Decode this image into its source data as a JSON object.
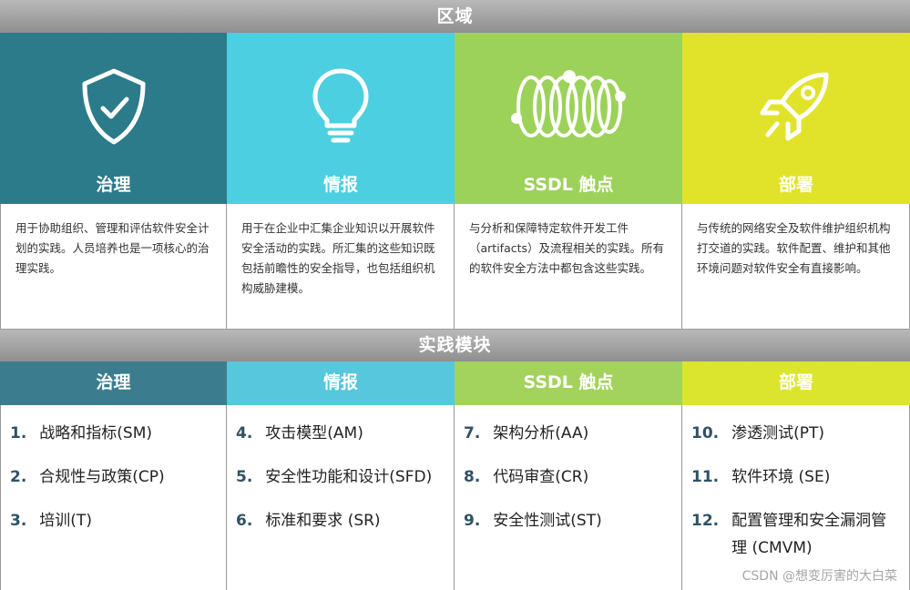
{
  "top_band": "区域",
  "middle_band": "实践模块",
  "colors": {
    "governance": "#2b7b8a",
    "intelligence": "#4ccfe1",
    "ssdl": "#9dd25a",
    "deployment": "#e1e32b",
    "governance_head": "#3b7d8e",
    "intelligence_head": "#56c7dc",
    "ssdl_head": "#a3d35c",
    "deployment_head": "#dce52e"
  },
  "domains": [
    {
      "title": "治理",
      "icon": "shield-check-icon",
      "description": "用于协助组织、管理和评估软件安全计划的实践。人员培养也是一项核心的治理实践。"
    },
    {
      "title": "情报",
      "icon": "lightbulb-icon",
      "description": "用于在企业中汇集企业知识以开展软件安全活动的实践。所汇集的这些知识既包括前瞻性的安全指导，也包括组织机构威胁建模。"
    },
    {
      "title": "SSDL 触点",
      "icon": "coil-icon",
      "description": "与分析和保障特定软件开发工件（artifacts）及流程相关的实践。所有的软件安全方法中都包含这些实践。"
    },
    {
      "title": "部署",
      "icon": "rocket-icon",
      "description": "与传统的网络安全及软件维护组织机构打交道的实践。软件配置、维护和其他环境问题对软件安全有直接影响。"
    }
  ],
  "modules": [
    {
      "title": "治理",
      "items": [
        {
          "num": "1.",
          "label": "战略和指标(SM)"
        },
        {
          "num": "2.",
          "label": "合规性与政策(CP)"
        },
        {
          "num": "3.",
          "label": "培训(T)"
        }
      ]
    },
    {
      "title": "情报",
      "items": [
        {
          "num": "4.",
          "label": "攻击模型(AM)"
        },
        {
          "num": "5.",
          "label": "安全性功能和设计(SFD)"
        },
        {
          "num": "6.",
          "label": "标准和要求 (SR)"
        }
      ]
    },
    {
      "title": "SSDL 触点",
      "items": [
        {
          "num": "7.",
          "label": "架构分析(AA)"
        },
        {
          "num": "8.",
          "label": "代码审查(CR)"
        },
        {
          "num": "9.",
          "label": "安全性测试(ST)"
        }
      ]
    },
    {
      "title": "部署",
      "items": [
        {
          "num": "10.",
          "label": "渗透测试(PT)"
        },
        {
          "num": "11.",
          "label": "软件环境 (SE)"
        },
        {
          "num": "12.",
          "label": "配置管理和安全漏洞管理 (CMVM)"
        }
      ]
    }
  ],
  "watermark": "CSDN @想变厉害的大白菜"
}
